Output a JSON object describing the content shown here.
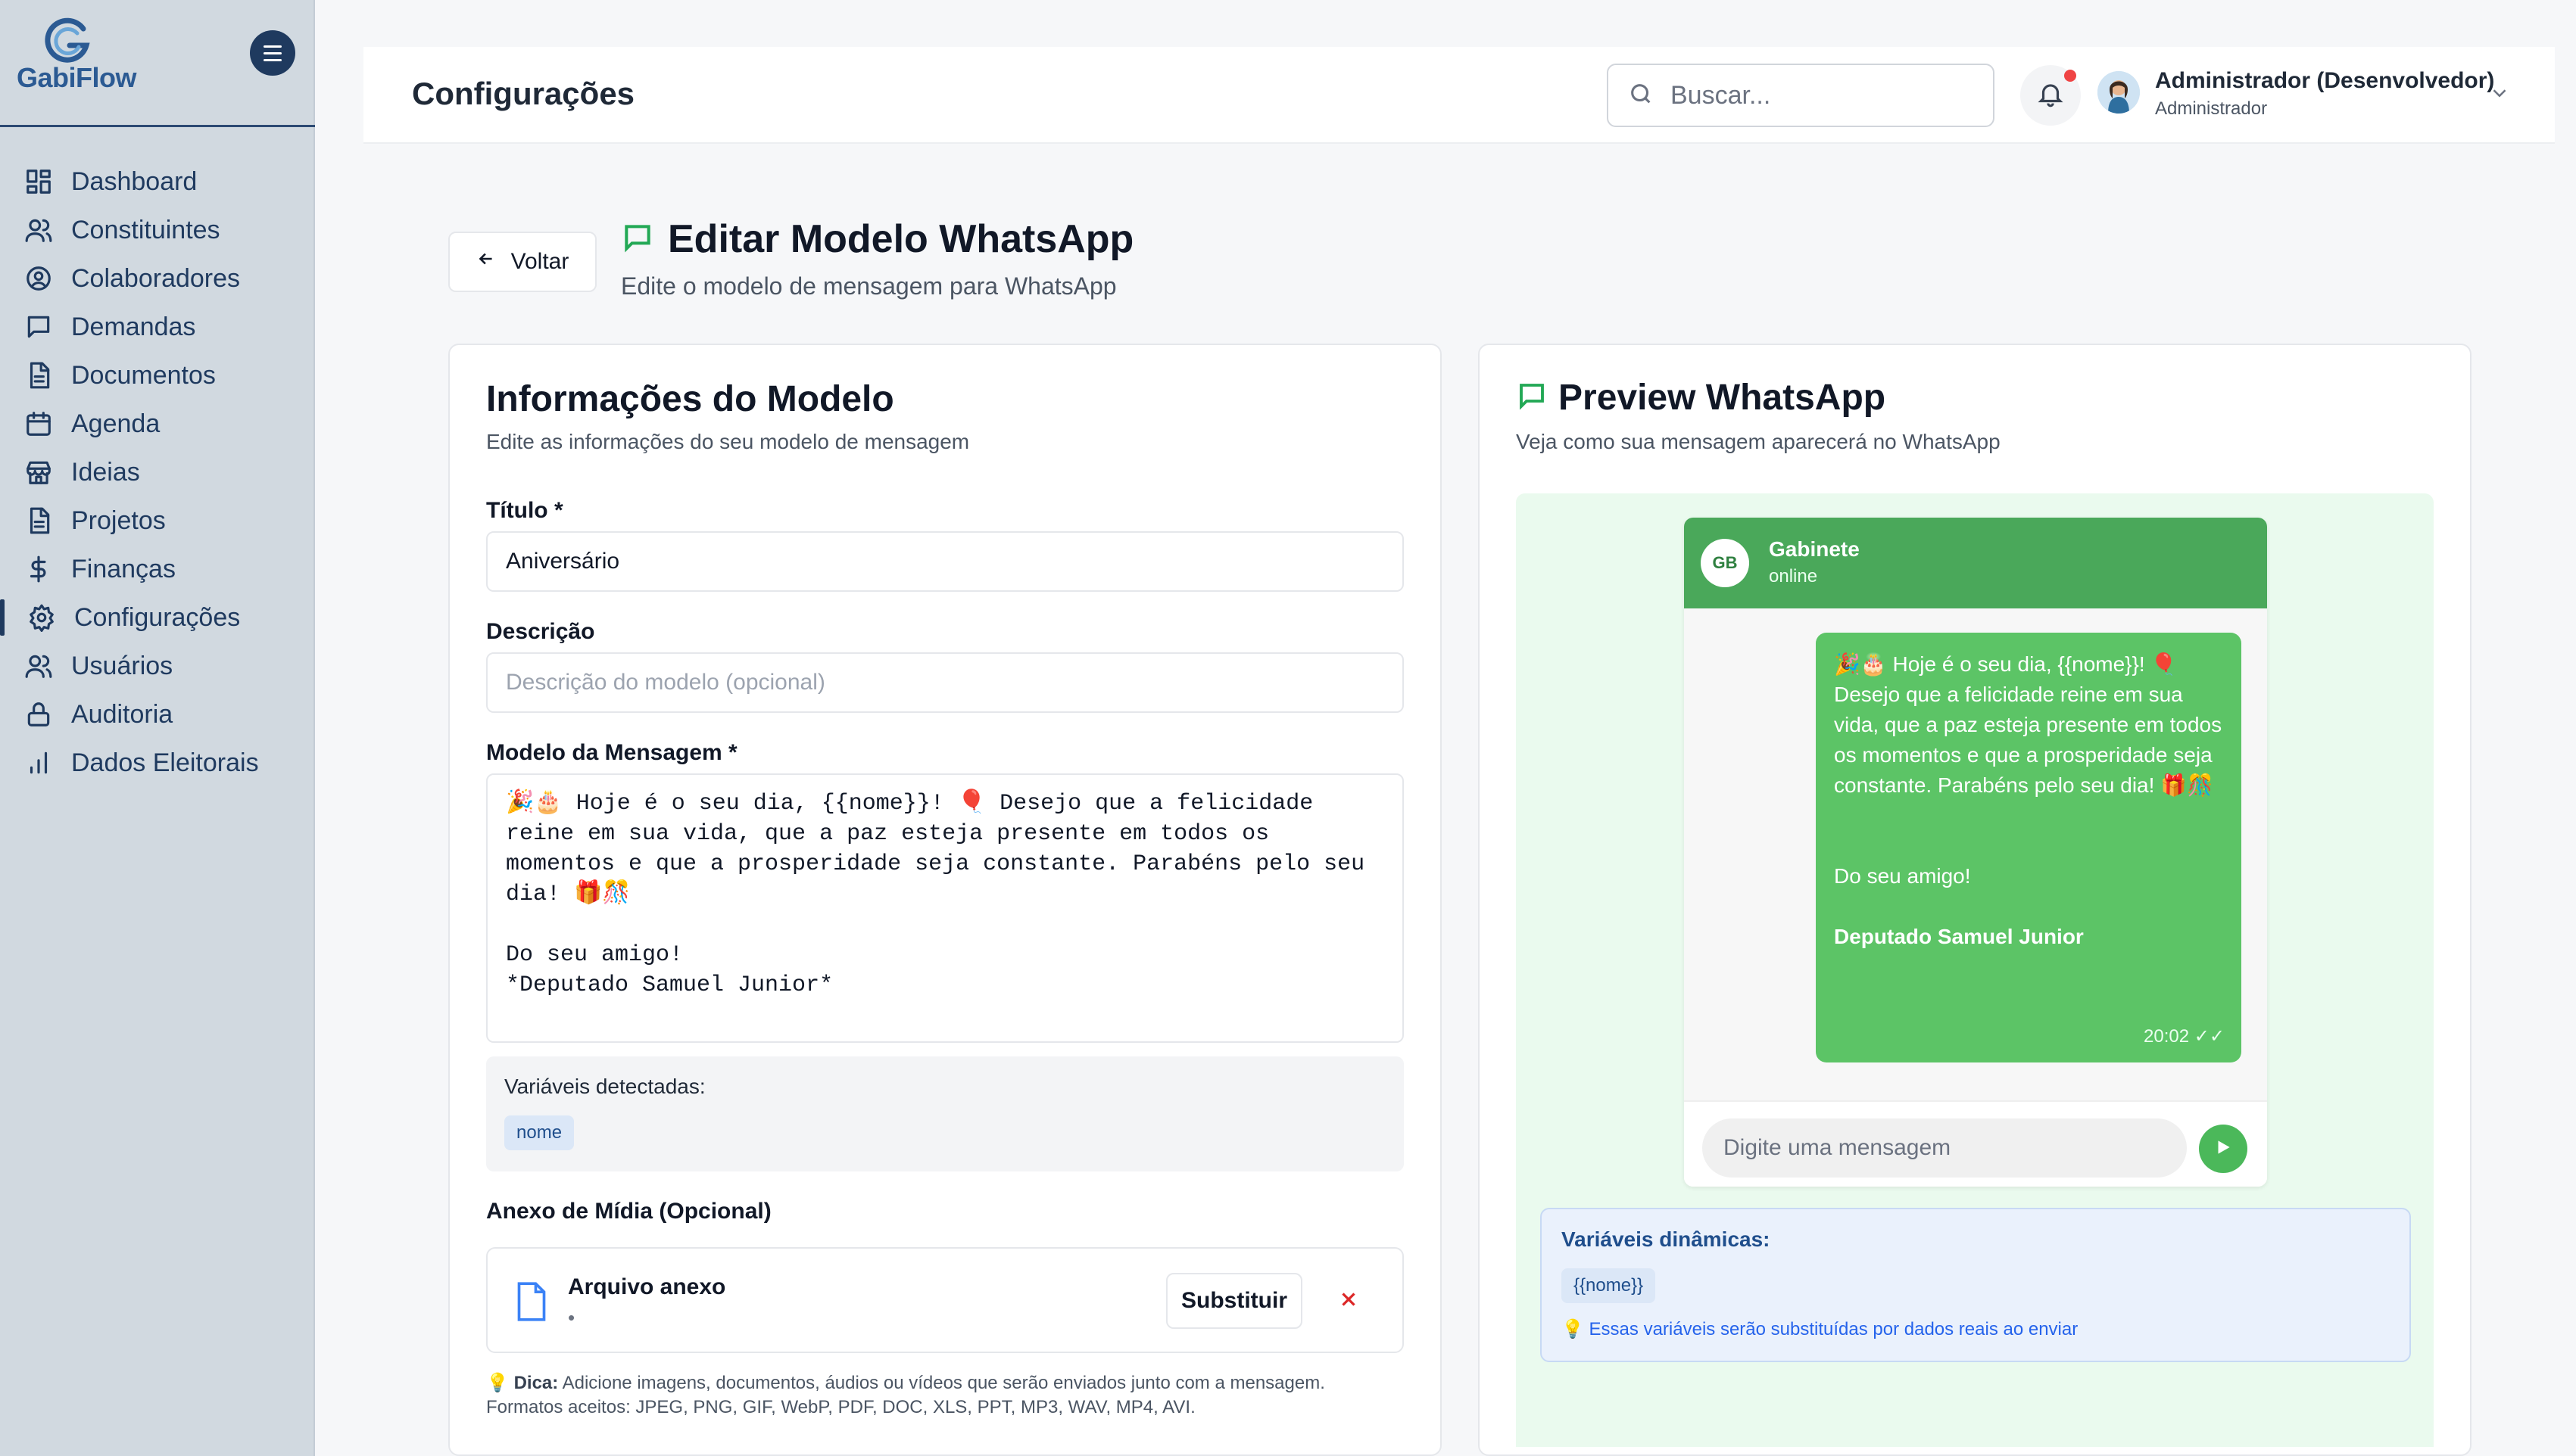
{
  "app": {
    "brand": "GabiFlow"
  },
  "sidebar": {
    "items": [
      {
        "label": "Dashboard",
        "icon": "dashboard-icon"
      },
      {
        "label": "Constituintes",
        "icon": "users-icon"
      },
      {
        "label": "Colaboradores",
        "icon": "user-circle-icon"
      },
      {
        "label": "Demandas",
        "icon": "message-icon"
      },
      {
        "label": "Documentos",
        "icon": "document-icon"
      },
      {
        "label": "Agenda",
        "icon": "calendar-icon"
      },
      {
        "label": "Ideias",
        "icon": "store-icon"
      },
      {
        "label": "Projetos",
        "icon": "document-icon"
      },
      {
        "label": "Finanças",
        "icon": "dollar-icon"
      },
      {
        "label": "Configurações",
        "icon": "gear-icon",
        "active": true
      },
      {
        "label": "Usuários",
        "icon": "users-icon"
      },
      {
        "label": "Auditoria",
        "icon": "lock-icon"
      },
      {
        "label": "Dados Eleitorais",
        "icon": "bar-chart-icon"
      }
    ]
  },
  "header": {
    "title": "Configurações",
    "search_placeholder": "Buscar...",
    "user_name": "Administrador (Desenvolvedor)",
    "user_role": "Administrador"
  },
  "page": {
    "back_label": "Voltar",
    "title": "Editar Modelo WhatsApp",
    "subtitle": "Edite o modelo de mensagem para WhatsApp"
  },
  "form": {
    "title": "Informações do Modelo",
    "subtitle": "Edite as informações do seu modelo de mensagem",
    "titulo_label": "Título *",
    "titulo_value": "Aniversário",
    "descricao_label": "Descrição",
    "descricao_placeholder": "Descrição do modelo (opcional)",
    "modelo_label": "Modelo da Mensagem *",
    "modelo_value": "🎉🎂 Hoje é o seu dia, {{nome}}! 🎈 Desejo que a felicidade reine em sua vida, que a paz esteja presente em todos os momentos e que a prosperidade seja constante. Parabéns pelo seu dia! 🎁🎊\n\nDo seu amigo!\n*Deputado Samuel Junior*",
    "vars_title": "Variáveis detectadas:",
    "vars": [
      "nome"
    ],
    "anexo_label": "Anexo de Mídia (Opcional)",
    "anexo_name": "Arquivo anexo",
    "anexo_meta": "•",
    "substituir_label": "Substituir",
    "tip_bold": "Dica:",
    "tip_text": " Adicione imagens, documentos, áudios ou vídeos que serão enviados junto com a mensagem.",
    "tip_formats": "Formatos aceitos: JPEG, PNG, GIF, WebP, PDF, DOC, XLS, PPT, MP3, WAV, MP4, AVI."
  },
  "preview": {
    "title": "Preview WhatsApp",
    "subtitle": "Veja como sua mensagem aparecerá no WhatsApp",
    "contact_initials": "GB",
    "contact_name": "Gabinete",
    "contact_status": "online",
    "bubble_text": "🎉🎂 Hoje é o seu dia, {{nome}}! 🎈 Desejo que a felicidade reine em sua vida, que a paz esteja presente em todos os momentos e que a prosperidade seja constante. Parabéns pelo seu dia! 🎁🎊",
    "bubble_closing": "Do seu amigo!",
    "bubble_signature": "Deputado Samuel Junior",
    "bubble_time": "20:02 ✓✓",
    "input_placeholder": "Digite uma mensagem",
    "dyn_title": "Variáveis dinâmicas:",
    "dyn_vars": [
      "{{nome}}"
    ],
    "dyn_note": "💡 Essas variáveis serão substituídas por dados reais ao enviar"
  },
  "colors": {
    "sidebar_bg": "#d1d9e0",
    "brand_navy": "#1f3a5f",
    "whatsapp_green": "#4aa85a",
    "bubble_green": "#5cc466",
    "danger": "#dc2626"
  }
}
